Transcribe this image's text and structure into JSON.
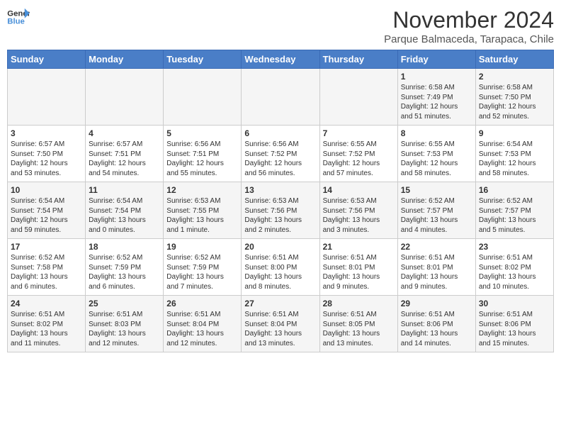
{
  "header": {
    "logo_general": "General",
    "logo_blue": "Blue",
    "title": "November 2024",
    "subtitle": "Parque Balmaceda, Tarapaca, Chile"
  },
  "days_of_week": [
    "Sunday",
    "Monday",
    "Tuesday",
    "Wednesday",
    "Thursday",
    "Friday",
    "Saturday"
  ],
  "weeks": [
    [
      {
        "day": "",
        "content": ""
      },
      {
        "day": "",
        "content": ""
      },
      {
        "day": "",
        "content": ""
      },
      {
        "day": "",
        "content": ""
      },
      {
        "day": "",
        "content": ""
      },
      {
        "day": "1",
        "content": "Sunrise: 6:58 AM\nSunset: 7:49 PM\nDaylight: 12 hours\nand 51 minutes."
      },
      {
        "day": "2",
        "content": "Sunrise: 6:58 AM\nSunset: 7:50 PM\nDaylight: 12 hours\nand 52 minutes."
      }
    ],
    [
      {
        "day": "3",
        "content": "Sunrise: 6:57 AM\nSunset: 7:50 PM\nDaylight: 12 hours\nand 53 minutes."
      },
      {
        "day": "4",
        "content": "Sunrise: 6:57 AM\nSunset: 7:51 PM\nDaylight: 12 hours\nand 54 minutes."
      },
      {
        "day": "5",
        "content": "Sunrise: 6:56 AM\nSunset: 7:51 PM\nDaylight: 12 hours\nand 55 minutes."
      },
      {
        "day": "6",
        "content": "Sunrise: 6:56 AM\nSunset: 7:52 PM\nDaylight: 12 hours\nand 56 minutes."
      },
      {
        "day": "7",
        "content": "Sunrise: 6:55 AM\nSunset: 7:52 PM\nDaylight: 12 hours\nand 57 minutes."
      },
      {
        "day": "8",
        "content": "Sunrise: 6:55 AM\nSunset: 7:53 PM\nDaylight: 12 hours\nand 58 minutes."
      },
      {
        "day": "9",
        "content": "Sunrise: 6:54 AM\nSunset: 7:53 PM\nDaylight: 12 hours\nand 58 minutes."
      }
    ],
    [
      {
        "day": "10",
        "content": "Sunrise: 6:54 AM\nSunset: 7:54 PM\nDaylight: 12 hours\nand 59 minutes."
      },
      {
        "day": "11",
        "content": "Sunrise: 6:54 AM\nSunset: 7:54 PM\nDaylight: 13 hours\nand 0 minutes."
      },
      {
        "day": "12",
        "content": "Sunrise: 6:53 AM\nSunset: 7:55 PM\nDaylight: 13 hours\nand 1 minute."
      },
      {
        "day": "13",
        "content": "Sunrise: 6:53 AM\nSunset: 7:56 PM\nDaylight: 13 hours\nand 2 minutes."
      },
      {
        "day": "14",
        "content": "Sunrise: 6:53 AM\nSunset: 7:56 PM\nDaylight: 13 hours\nand 3 minutes."
      },
      {
        "day": "15",
        "content": "Sunrise: 6:52 AM\nSunset: 7:57 PM\nDaylight: 13 hours\nand 4 minutes."
      },
      {
        "day": "16",
        "content": "Sunrise: 6:52 AM\nSunset: 7:57 PM\nDaylight: 13 hours\nand 5 minutes."
      }
    ],
    [
      {
        "day": "17",
        "content": "Sunrise: 6:52 AM\nSunset: 7:58 PM\nDaylight: 13 hours\nand 6 minutes."
      },
      {
        "day": "18",
        "content": "Sunrise: 6:52 AM\nSunset: 7:59 PM\nDaylight: 13 hours\nand 6 minutes."
      },
      {
        "day": "19",
        "content": "Sunrise: 6:52 AM\nSunset: 7:59 PM\nDaylight: 13 hours\nand 7 minutes."
      },
      {
        "day": "20",
        "content": "Sunrise: 6:51 AM\nSunset: 8:00 PM\nDaylight: 13 hours\nand 8 minutes."
      },
      {
        "day": "21",
        "content": "Sunrise: 6:51 AM\nSunset: 8:01 PM\nDaylight: 13 hours\nand 9 minutes."
      },
      {
        "day": "22",
        "content": "Sunrise: 6:51 AM\nSunset: 8:01 PM\nDaylight: 13 hours\nand 9 minutes."
      },
      {
        "day": "23",
        "content": "Sunrise: 6:51 AM\nSunset: 8:02 PM\nDaylight: 13 hours\nand 10 minutes."
      }
    ],
    [
      {
        "day": "24",
        "content": "Sunrise: 6:51 AM\nSunset: 8:02 PM\nDaylight: 13 hours\nand 11 minutes."
      },
      {
        "day": "25",
        "content": "Sunrise: 6:51 AM\nSunset: 8:03 PM\nDaylight: 13 hours\nand 12 minutes."
      },
      {
        "day": "26",
        "content": "Sunrise: 6:51 AM\nSunset: 8:04 PM\nDaylight: 13 hours\nand 12 minutes."
      },
      {
        "day": "27",
        "content": "Sunrise: 6:51 AM\nSunset: 8:04 PM\nDaylight: 13 hours\nand 13 minutes."
      },
      {
        "day": "28",
        "content": "Sunrise: 6:51 AM\nSunset: 8:05 PM\nDaylight: 13 hours\nand 13 minutes."
      },
      {
        "day": "29",
        "content": "Sunrise: 6:51 AM\nSunset: 8:06 PM\nDaylight: 13 hours\nand 14 minutes."
      },
      {
        "day": "30",
        "content": "Sunrise: 6:51 AM\nSunset: 8:06 PM\nDaylight: 13 hours\nand 15 minutes."
      }
    ]
  ]
}
